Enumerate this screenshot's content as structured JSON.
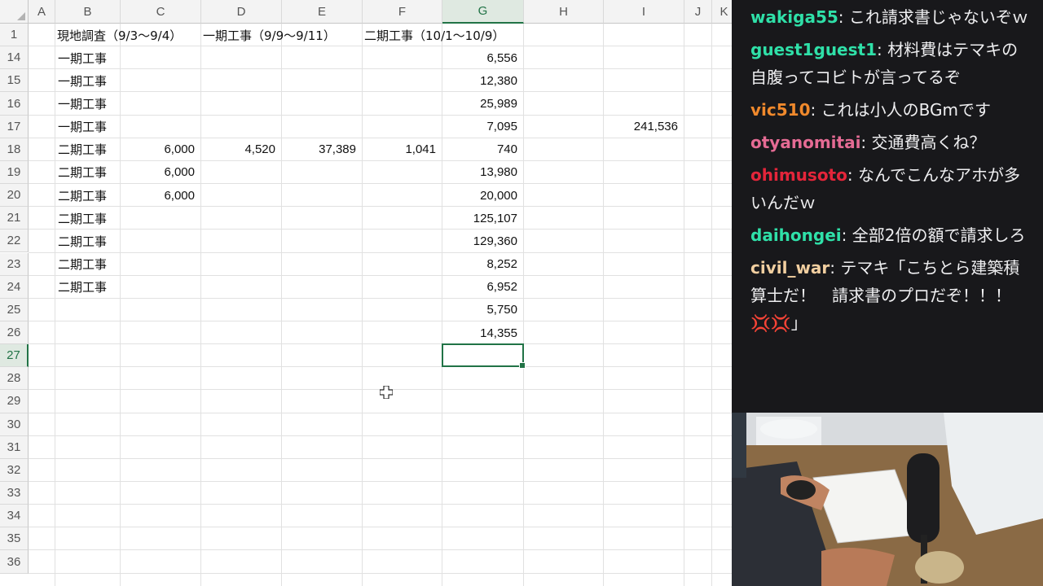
{
  "spreadsheet": {
    "columns": [
      "A",
      "B",
      "C",
      "D",
      "E",
      "F",
      "G",
      "H",
      "I",
      "J",
      "K"
    ],
    "selected_column": "G",
    "row_numbers": [
      "1",
      "14",
      "15",
      "16",
      "17",
      "18",
      "19",
      "20",
      "21",
      "22",
      "23",
      "24",
      "25",
      "26",
      "27",
      "28",
      "29",
      "30",
      "31",
      "32",
      "33",
      "34",
      "35",
      "36"
    ],
    "selected_row": "27",
    "header_row": {
      "B": "現地調査（9/3～9/4）",
      "D": "一期工事（9/9～9/11）",
      "F": "二期工事（10/1～10/9）"
    },
    "rows": [
      {
        "row": "14",
        "B": "一期工事",
        "C": "",
        "D": "",
        "E": "",
        "F": "",
        "G": "6,556",
        "I": ""
      },
      {
        "row": "15",
        "B": "一期工事",
        "C": "",
        "D": "",
        "E": "",
        "F": "",
        "G": "12,380",
        "I": ""
      },
      {
        "row": "16",
        "B": "一期工事",
        "C": "",
        "D": "",
        "E": "",
        "F": "",
        "G": "25,989",
        "I": ""
      },
      {
        "row": "17",
        "B": "一期工事",
        "C": "",
        "D": "",
        "E": "",
        "F": "",
        "G": "7,095",
        "I": "241,536"
      },
      {
        "row": "18",
        "B": "二期工事",
        "C": "6,000",
        "D": "4,520",
        "E": "37,389",
        "F": "1,041",
        "G": "740",
        "I": ""
      },
      {
        "row": "19",
        "B": "二期工事",
        "C": "6,000",
        "D": "",
        "E": "",
        "F": "",
        "G": "13,980",
        "I": ""
      },
      {
        "row": "20",
        "B": "二期工事",
        "C": "6,000",
        "D": "",
        "E": "",
        "F": "",
        "G": "20,000",
        "I": ""
      },
      {
        "row": "21",
        "B": "二期工事",
        "C": "",
        "D": "",
        "E": "",
        "F": "",
        "G": "125,107",
        "I": ""
      },
      {
        "row": "22",
        "B": "二期工事",
        "C": "",
        "D": "",
        "E": "",
        "F": "",
        "G": "129,360",
        "I": ""
      },
      {
        "row": "23",
        "B": "二期工事",
        "C": "",
        "D": "",
        "E": "",
        "F": "",
        "G": "8,252",
        "I": ""
      },
      {
        "row": "24",
        "B": "二期工事",
        "C": "",
        "D": "",
        "E": "",
        "F": "",
        "G": "6,952",
        "I": ""
      },
      {
        "row": "25",
        "B": "",
        "C": "",
        "D": "",
        "E": "",
        "F": "",
        "G": "5,750",
        "I": ""
      },
      {
        "row": "26",
        "B": "",
        "C": "",
        "D": "",
        "E": "",
        "F": "",
        "G": "14,355",
        "I": ""
      }
    ],
    "active_cell": "G27"
  },
  "chat": {
    "messages": [
      {
        "user": "wakiga55",
        "color": "#2fe0a8",
        "text": "これ請求書じゃないぞｗ"
      },
      {
        "user": "guest1guest1",
        "color": "#2fe0a8",
        "text": "材料費はテマキの自腹ってコビトが言ってるぞ"
      },
      {
        "user": "vic510",
        "color": "#f0892c",
        "text": "これは小人のBGmです"
      },
      {
        "user": "otyanomitai",
        "color": "#e56b94",
        "text": "交通費高くね？"
      },
      {
        "user": "ohimusoto",
        "color": "#e4253a",
        "text": "なんでこんなアホが多いんだｗ"
      },
      {
        "user": "daihongei",
        "color": "#2fe0a8",
        "text": "全部2倍の額で請求しろ"
      },
      {
        "user": "civil_war",
        "color": "#f2cfa0",
        "text": "テマキ「こちとら建築積算士だ！　請求書のプロだぞ！！！💢💢」"
      }
    ]
  },
  "webcam": {
    "colors": {
      "desk": "#8a6a45",
      "shirt": "#e9ecef",
      "skin": "#c08462",
      "keyboard": "#2c2f36",
      "wall": "#d8dbde"
    }
  }
}
